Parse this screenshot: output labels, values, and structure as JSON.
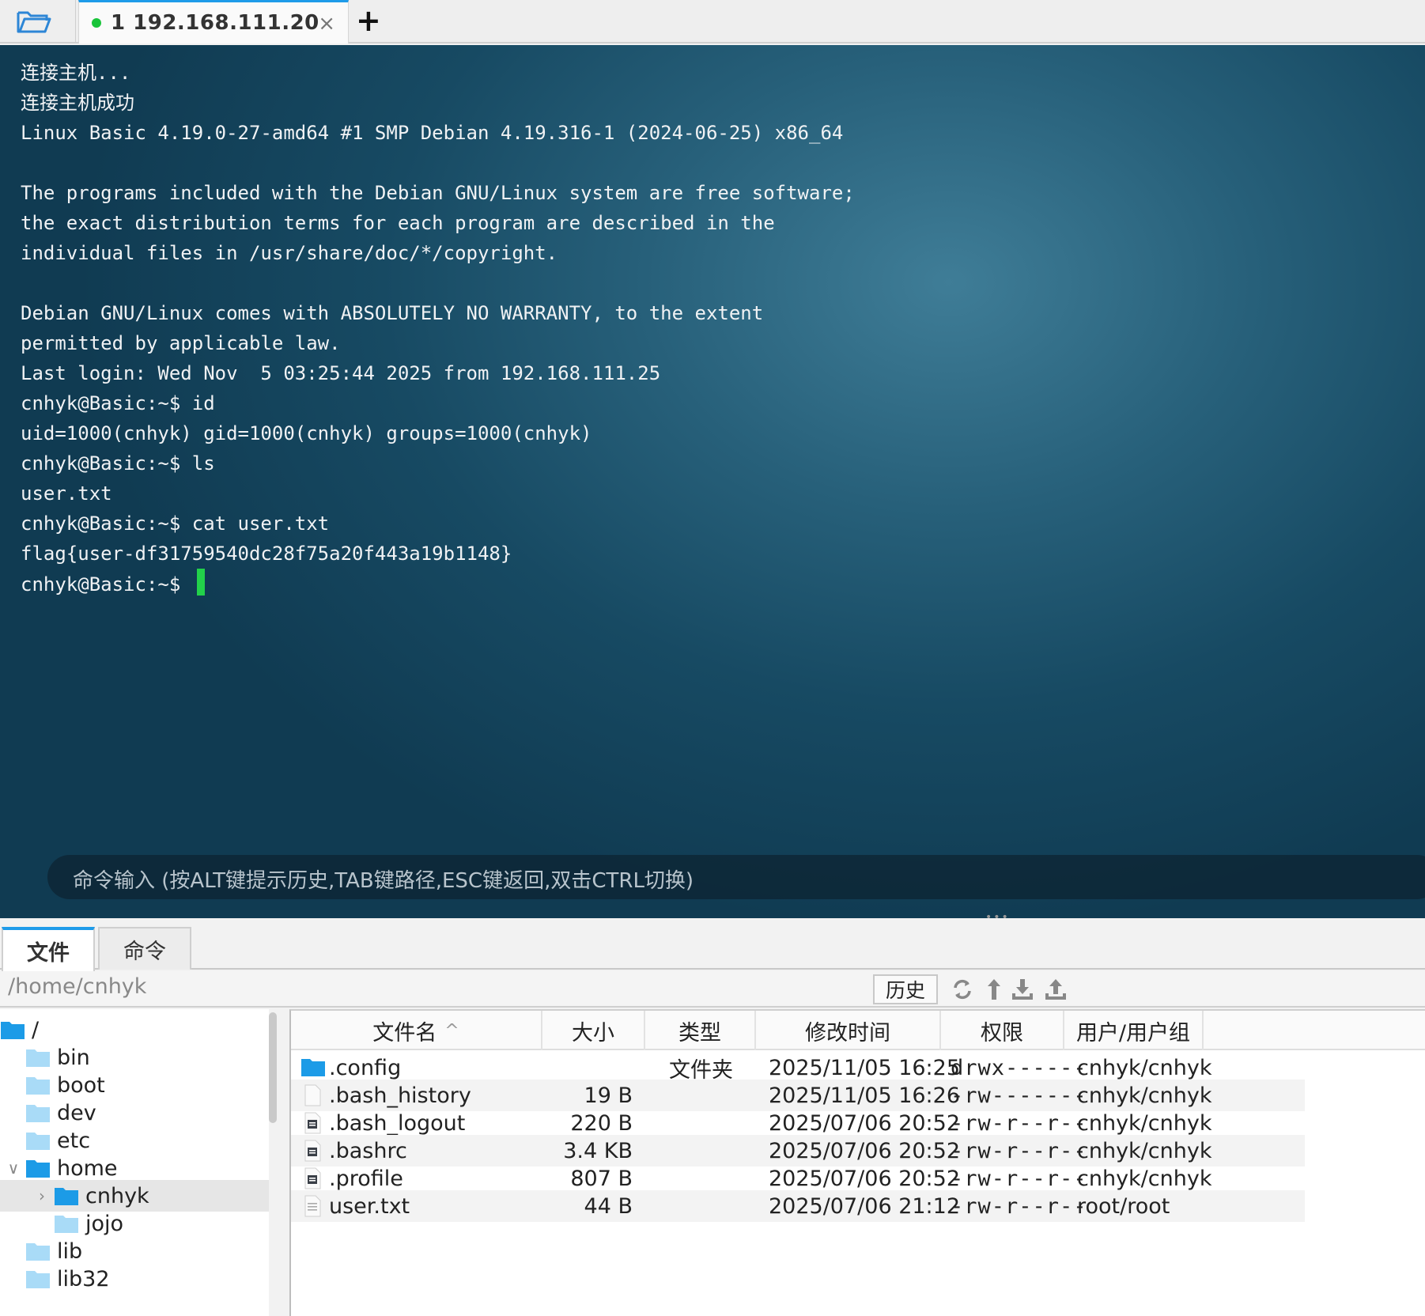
{
  "tabbar": {
    "tab_title": "1  192.168.111.20",
    "close_glyph": "×",
    "add_glyph": "+",
    "status_color": "#19c43a"
  },
  "terminal": {
    "lines": [
      "连接主机...",
      "连接主机成功",
      "Linux Basic 4.19.0-27-amd64 #1 SMP Debian 4.19.316-1 (2024-06-25) x86_64",
      "",
      "The programs included with the Debian GNU/Linux system are free software;",
      "the exact distribution terms for each program are described in the",
      "individual files in /usr/share/doc/*/copyright.",
      "",
      "Debian GNU/Linux comes with ABSOLUTELY NO WARRANTY, to the extent",
      "permitted by applicable law.",
      "Last login: Wed Nov  5 03:25:44 2025 from 192.168.111.25",
      "cnhyk@Basic:~$ id",
      "uid=1000(cnhyk) gid=1000(cnhyk) groups=1000(cnhyk)",
      "cnhyk@Basic:~$ ls",
      "user.txt",
      "cnhyk@Basic:~$ cat user.txt",
      "flag{user-df31759540dc28f75a20f443a19b1148}"
    ],
    "prompt": "cnhyk@Basic:~$ ",
    "cursor_color": "#22d14a",
    "command_placeholder": "命令输入 (按ALT键提示历史,TAB键路径,ESC键返回,双击CTRL切换)",
    "splitter": "•••"
  },
  "panel": {
    "tabs": [
      "文件",
      "命令"
    ],
    "path": "/home/cnhyk",
    "history_label": "历史",
    "tools": [
      "refresh-icon",
      "up-dir-icon",
      "download-icon",
      "upload-icon"
    ]
  },
  "tree": [
    {
      "label": "/",
      "chev": "",
      "depth": 0
    },
    {
      "label": "bin",
      "chev": "",
      "depth": 1
    },
    {
      "label": "boot",
      "chev": "",
      "depth": 1
    },
    {
      "label": "dev",
      "chev": "",
      "depth": 1
    },
    {
      "label": "etc",
      "chev": "",
      "depth": 1
    },
    {
      "label": "home",
      "chev": "∨",
      "depth": 1
    },
    {
      "label": "cnhyk",
      "chev": "›",
      "depth": 2,
      "selected": true
    },
    {
      "label": "jojo",
      "chev": "",
      "depth": 2
    },
    {
      "label": "lib",
      "chev": "",
      "depth": 1
    },
    {
      "label": "lib32",
      "chev": "",
      "depth": 1
    }
  ],
  "files": {
    "headers": [
      "文件名",
      "大小",
      "类型",
      "修改时间",
      "权限",
      "用户/用户组"
    ],
    "sort_indicator": "^",
    "rows": [
      {
        "name": ".config",
        "size": "",
        "type": "文件夹",
        "mtime": "2025/11/05 16:25",
        "perm": "drwx------",
        "owner": "cnhyk/cnhyk",
        "icon": "folder-icon"
      },
      {
        "name": ".bash_history",
        "size": "19 B",
        "type": "",
        "mtime": "2025/11/05 16:26",
        "perm": "-rw-------",
        "owner": "cnhyk/cnhyk",
        "icon": "file-icon"
      },
      {
        "name": ".bash_logout",
        "size": "220 B",
        "type": "",
        "mtime": "2025/07/06 20:52",
        "perm": "-rw-r--r--",
        "owner": "cnhyk/cnhyk",
        "icon": "text-file-icon"
      },
      {
        "name": ".bashrc",
        "size": "3.4 KB",
        "type": "",
        "mtime": "2025/07/06 20:52",
        "perm": "-rw-r--r--",
        "owner": "cnhyk/cnhyk",
        "icon": "text-file-icon"
      },
      {
        "name": ".profile",
        "size": "807 B",
        "type": "",
        "mtime": "2025/07/06 20:52",
        "perm": "-rw-r--r--",
        "owner": "cnhyk/cnhyk",
        "icon": "text-file-icon"
      },
      {
        "name": "user.txt",
        "size": "44 B",
        "type": "",
        "mtime": "2025/07/06 21:12",
        "perm": "-rw-r--r--",
        "owner": "root/root",
        "icon": "doc-file-icon"
      }
    ]
  }
}
